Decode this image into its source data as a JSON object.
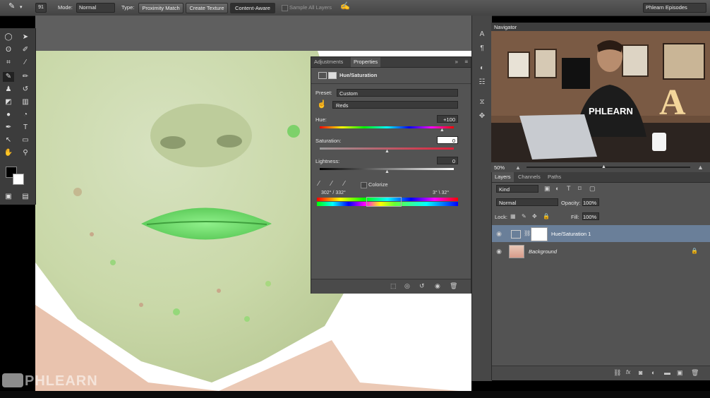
{
  "options_bar": {
    "brush_size": "91",
    "mode_label": "Mode:",
    "mode_value": "Normal",
    "type_label": "Type:",
    "type_buttons": [
      "Proximity Match",
      "Create Texture",
      "Content-Aware"
    ],
    "sample_all_layers": "Sample All Layers",
    "workspace": "Phlearn Episodes"
  },
  "properties": {
    "tabs": [
      "Adjustments",
      "Properties"
    ],
    "adjustment_title": "Hue/Saturation",
    "preset_label": "Preset:",
    "preset_value": "Custom",
    "channel_value": "Reds",
    "hue_label": "Hue:",
    "hue_value": "+100",
    "hue_level": 0.91,
    "saturation_label": "Saturation:",
    "saturation_value": "0",
    "saturation_level": 0.5,
    "lightness_label": "Lightness:",
    "lightness_value": "0",
    "lightness_level": 0.5,
    "colorize_label": "Colorize",
    "range_left": "302° / 332°",
    "range_right": "3° \\ 32°"
  },
  "navigator": {
    "title": "Navigator",
    "zoom": "50%",
    "shirt_text": "PHLEARN",
    "sign_letter": "A"
  },
  "layers": {
    "tabs": [
      "Layers",
      "Channels",
      "Paths"
    ],
    "filter_value": "Kind",
    "blend_mode": "Normal",
    "opacity_label": "Opacity:",
    "opacity_value": "100%",
    "lock_label": "Lock:",
    "fill_label": "Fill:",
    "fill_value": "100%",
    "items": [
      {
        "name": "Hue/Saturation 1",
        "selected": true
      },
      {
        "name": "Background",
        "selected": false
      }
    ]
  },
  "watermark": "PHLEARN",
  "colors": {
    "panel": "#535353",
    "panel_dark": "#3d3d3d",
    "selection": "#6a7f99",
    "lip_green": "#6fdd6a"
  }
}
